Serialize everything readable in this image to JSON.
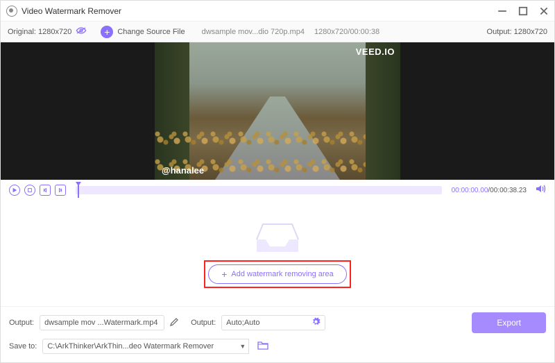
{
  "app": {
    "title": "Video Watermark Remover"
  },
  "toolbar": {
    "original_label": "Original: 1280x720",
    "change_source": "Change Source File",
    "filename": "dwsample mov...dio 720p.mp4",
    "dimensions_duration": "1280x720/00:00:38",
    "output_label": "Output: 1280x720"
  },
  "preview": {
    "watermark_top": "VEED.IO",
    "watermark_bottom": "@hanalee"
  },
  "player": {
    "current_time": "00:00:00.00",
    "total_time": "/00:00:38.23"
  },
  "droparea": {
    "add_button": "Add watermark removing area"
  },
  "bottom": {
    "output_label": "Output:",
    "output_filename": "dwsample mov ...Watermark.mp4",
    "format_label": "Output:",
    "format_value": "Auto;Auto",
    "saveto_label": "Save to:",
    "saveto_path": "C:\\ArkThinker\\ArkThin...deo Watermark Remover",
    "export_label": "Export"
  }
}
